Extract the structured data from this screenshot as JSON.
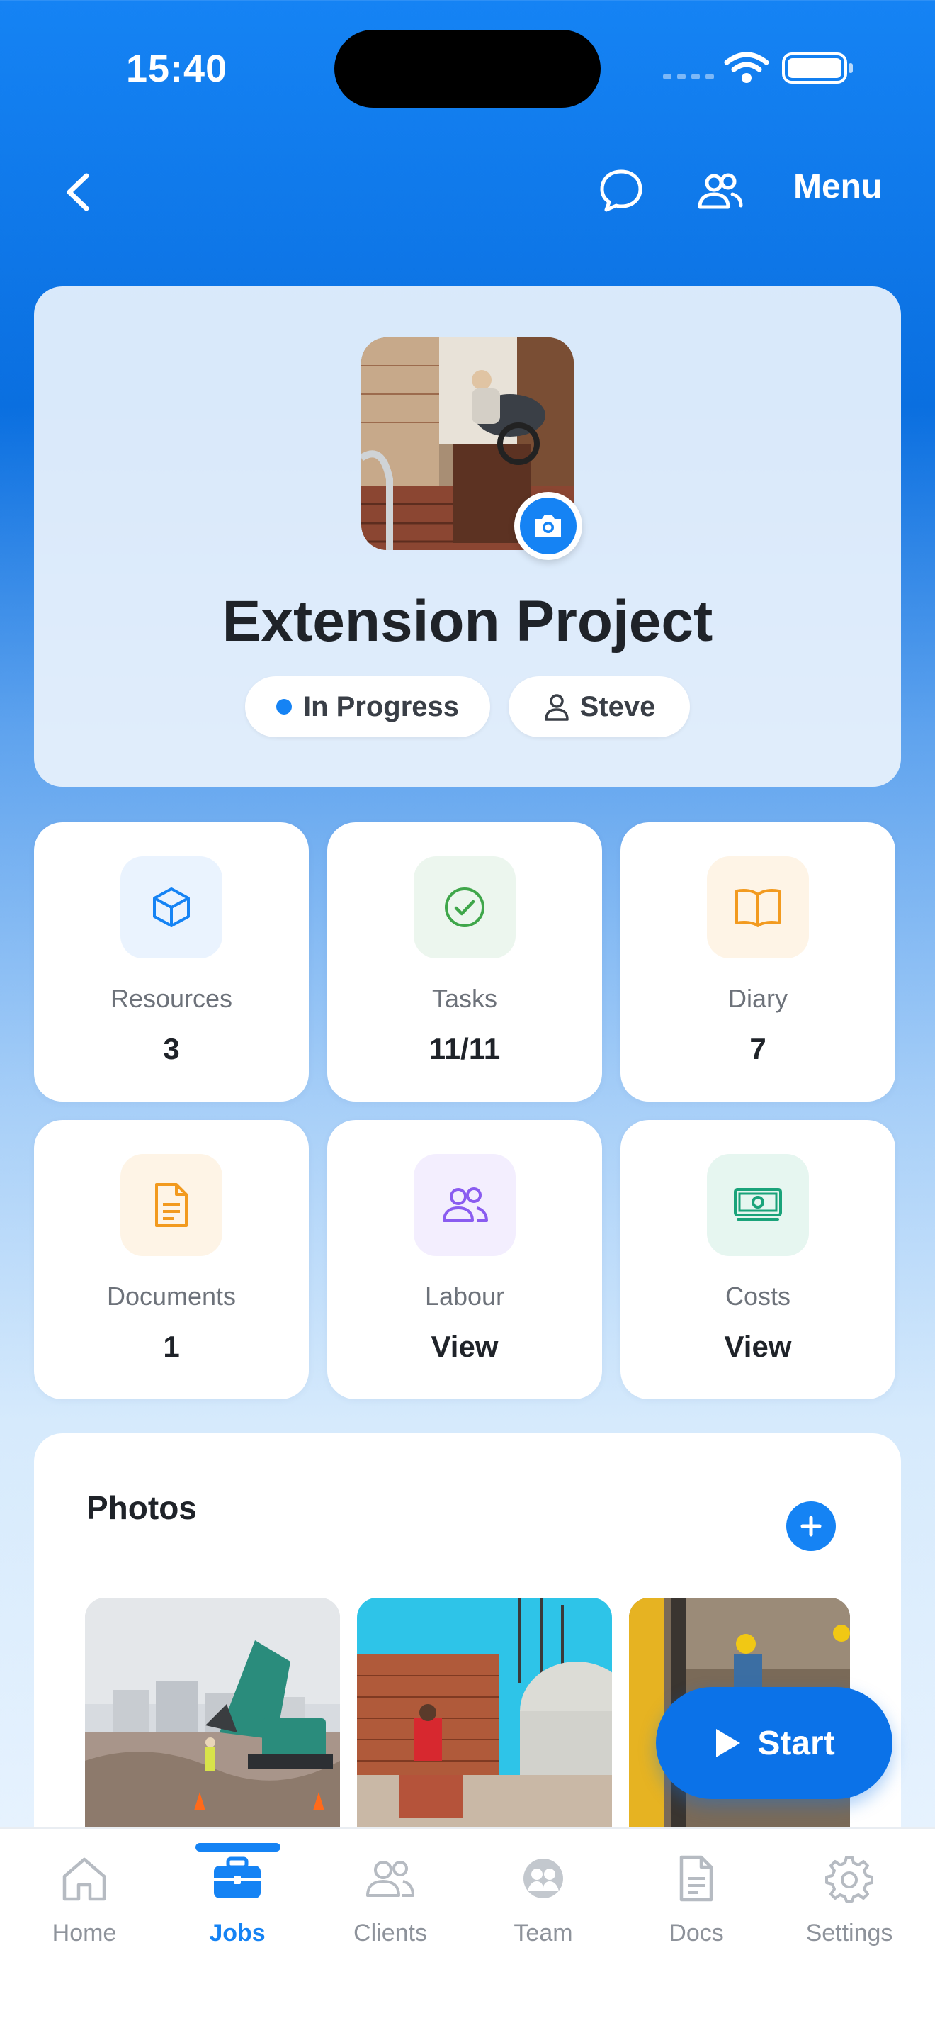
{
  "status_bar": {
    "time": "15:40"
  },
  "nav": {
    "back_icon": "chevron-left-icon",
    "chat_icon": "chat-bubble-icon",
    "team_icon": "people-icon",
    "menu_label": "Menu"
  },
  "project": {
    "title": "Extension Project",
    "status_label": "In Progress",
    "status_color": "#1583f4",
    "owner_name": "Steve"
  },
  "tiles": [
    {
      "label": "Resources",
      "value": "3",
      "icon": "cube-icon",
      "color": "#1583f4",
      "bg": "#eaf3fe"
    },
    {
      "label": "Tasks",
      "value": "11/11",
      "icon": "check-circle-icon",
      "color": "#3fa64a",
      "bg": "#ecf6ee"
    },
    {
      "label": "Diary",
      "value": "7",
      "icon": "book-icon",
      "color": "#f29a1f",
      "bg": "#fef4e6"
    },
    {
      "label": "Documents",
      "value": "1",
      "icon": "document-icon",
      "color": "#f29a1f",
      "bg": "#fef4e6"
    },
    {
      "label": "Labour",
      "value": "View",
      "icon": "people-icon",
      "color": "#8a5cf0",
      "bg": "#f3eefe"
    },
    {
      "label": "Costs",
      "value": "View",
      "icon": "cash-icon",
      "color": "#1aa37a",
      "bg": "#e6f6f0"
    }
  ],
  "photos": {
    "title": "Photos",
    "add_icon": "plus-icon"
  },
  "start_button": {
    "label": "Start"
  },
  "tab_bar": {
    "items": [
      {
        "label": "Home",
        "icon": "home-icon"
      },
      {
        "label": "Jobs",
        "icon": "briefcase-icon"
      },
      {
        "label": "Clients",
        "icon": "people-icon"
      },
      {
        "label": "Team",
        "icon": "team-icon"
      },
      {
        "label": "Docs",
        "icon": "document-icon"
      },
      {
        "label": "Settings",
        "icon": "gear-icon"
      }
    ],
    "active": "Jobs",
    "accent_color": "#1583f4"
  }
}
